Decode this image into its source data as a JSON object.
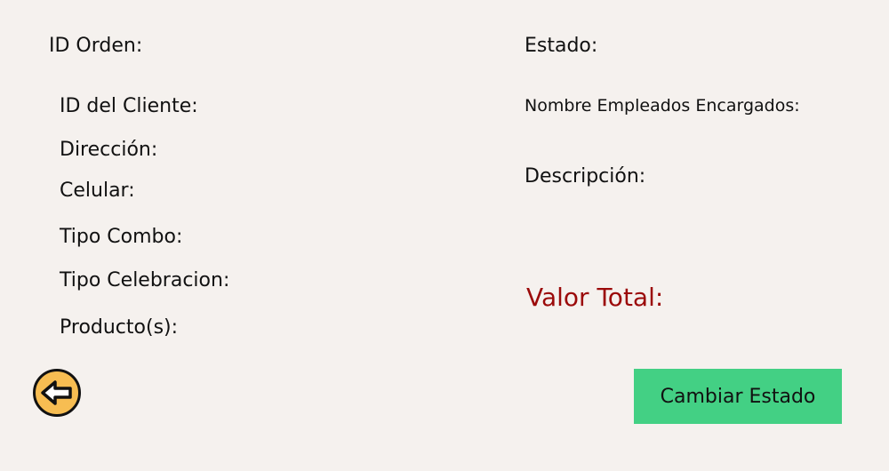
{
  "order": {
    "id_label": "ID Orden:",
    "status_label": "Estado:"
  },
  "client": {
    "id_label": "ID del Cliente:",
    "address_label": "Dirección:",
    "phone_label": "Celular:",
    "combo_label": "Tipo Combo:",
    "celebration_label": "Tipo Celebracion:",
    "products_label": "Producto(s):"
  },
  "details": {
    "employees_label": "Nombre Empleados Encargados:",
    "description_label": "Descripción:",
    "total_label": "Valor Total:"
  },
  "actions": {
    "back_icon": "arrow-left-icon",
    "change_status_label": "Cambiar Estado"
  },
  "colors": {
    "background": "#f5f1ee",
    "total_text": "#9b0a0a",
    "back_button": "#f7bd52",
    "action_button": "#43d084"
  }
}
